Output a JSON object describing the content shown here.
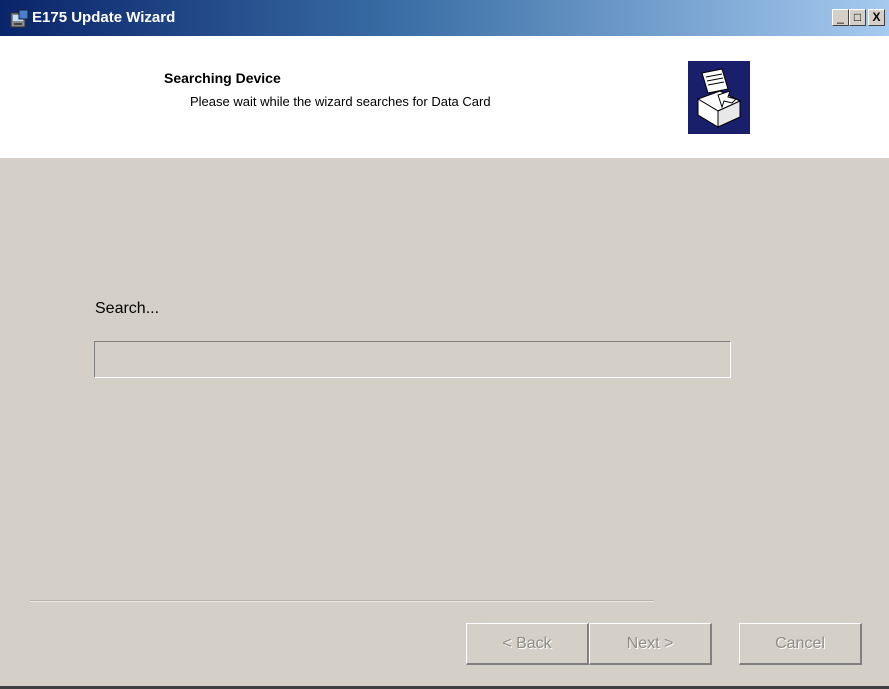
{
  "window": {
    "title": "E175 Update Wizard",
    "title_buttons": {
      "minimize": "_",
      "maximize": "□",
      "close": "X"
    }
  },
  "header": {
    "title": "Searching Device",
    "subtitle": "Please wait while the wizard searches for Data Card",
    "graphic_icon": "installer-box-icon"
  },
  "body": {
    "status_label": "Search...",
    "progress_fraction": 0
  },
  "buttons": {
    "back_label": "< Back",
    "next_label": "Next >",
    "cancel_label": "Cancel"
  },
  "colors": {
    "titlebar_start": "#0a246a",
    "titlebar_end": "#a6caf0",
    "dialog_background": "#d4d0c8",
    "header_background": "#ffffff",
    "disabled_text": "#8f8c86"
  }
}
